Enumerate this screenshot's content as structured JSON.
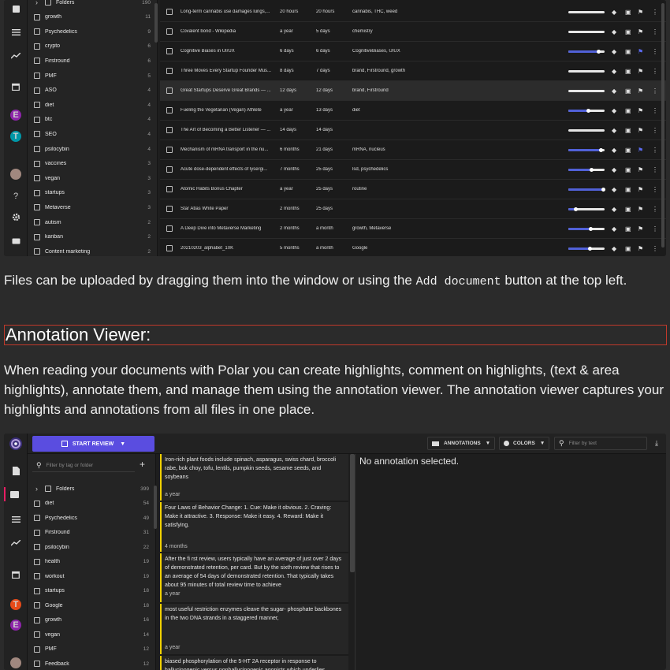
{
  "screenshot1": {
    "tags": [
      {
        "label": "Folders",
        "count": "190"
      },
      {
        "label": "growth",
        "count": "11"
      },
      {
        "label": "Psychedelics",
        "count": "9"
      },
      {
        "label": "crypto",
        "count": "6"
      },
      {
        "label": "Firstround",
        "count": "6"
      },
      {
        "label": "PMF",
        "count": "5"
      },
      {
        "label": "ASO",
        "count": "4"
      },
      {
        "label": "diet",
        "count": "4"
      },
      {
        "label": "btc",
        "count": "4"
      },
      {
        "label": "SEO",
        "count": "4"
      },
      {
        "label": "psilocybin",
        "count": "4"
      },
      {
        "label": "vaccines",
        "count": "3"
      },
      {
        "label": "vegan",
        "count": "3"
      },
      {
        "label": "startups",
        "count": "3"
      },
      {
        "label": "Metaverse",
        "count": "3"
      },
      {
        "label": "autism",
        "count": "2"
      },
      {
        "label": "kanban",
        "count": "2"
      },
      {
        "label": "Content marketing",
        "count": "2"
      }
    ],
    "rail_avatars": [
      {
        "letter": "E",
        "color": "#8e24aa"
      },
      {
        "letter": "T",
        "color": "#0097a7"
      }
    ],
    "rail_help": "?",
    "documents": [
      {
        "title": "Long-term cannabis use damages lungs,...",
        "added": "20 hours",
        "updated": "20 hours",
        "tags": "cannabis, THC, weed",
        "progress": 0
      },
      {
        "title": "Covalent bond - Wikipedia",
        "added": "a year",
        "updated": "5 days",
        "tags": "chemistry",
        "progress": 0
      },
      {
        "title": "Cognitive Biases in UI/UX",
        "added": "6 days",
        "updated": "6 days",
        "tags": "CognitiveBiases, UIUX",
        "progress": 0.82
      },
      {
        "title": "Three Moves Every Startup Founder Mus...",
        "added": "8 days",
        "updated": "7 days",
        "tags": "brand, Firstround, growth",
        "progress": 0
      },
      {
        "title": "Great Startups Deserve Great Brands — ...",
        "added": "12 days",
        "updated": "12 days",
        "tags": "brand, Firstround",
        "progress": 0
      },
      {
        "title": "Fueling the Vegetarian (Vegan) Athlete",
        "added": "a year",
        "updated": "13 days",
        "tags": "diet",
        "progress": 0.55
      },
      {
        "title": "The Art of Becoming a Better Listener — ...",
        "added": "14 days",
        "updated": "14 days",
        "tags": "",
        "progress": 0
      },
      {
        "title": "Mechanism of mRNA transport in the nu...",
        "added": "6 months",
        "updated": "21 days",
        "tags": "mRNA, nucleus",
        "progress": 0.9
      },
      {
        "title": "Acute dose-dependent effects of lysergi...",
        "added": "7 months",
        "updated": "25 days",
        "tags": "lsd, psychedelics",
        "progress": 0.62
      },
      {
        "title": "Atomic Habits Bonus Chapter",
        "added": "a year",
        "updated": "25 days",
        "tags": "routine",
        "progress": 0.95
      },
      {
        "title": "Star Atlas White Paper",
        "added": "2 months",
        "updated": "25 days",
        "tags": "",
        "progress": 0.2
      },
      {
        "title": "A Deep Dive into Metaverse Marketing",
        "added": "2 months",
        "updated": "a month",
        "tags": "growth, Metaverse",
        "progress": 0.6
      },
      {
        "title": "20210203_alphabet_10K",
        "added": "5 months",
        "updated": "a month",
        "tags": "Google",
        "progress": 0.58
      }
    ]
  },
  "paragraph1": {
    "before": "Files can be uploaded by dragging them into the window or using the ",
    "code": "Add document",
    "after": " button at the top left."
  },
  "heading": "Annotation Viewer:",
  "paragraph2": "When reading your documents with Polar you can create highlights, comment on highlights, (text & area highlights), annotate them, and manage them using the annotation viewer. The annotation viewer captures your highlights and annotations from all files in one place.",
  "screenshot2": {
    "start_review": "START REVIEW",
    "annotations_btn": "ANNOTATIONS",
    "colors_btn": "COLORS",
    "filter_placeholder": "Filter by text",
    "tag_filter_placeholder": "Filter by tag or folder",
    "no_selection": "No annotation selected.",
    "rail_avatars": [
      {
        "letter": "T",
        "color": "#e64a19"
      },
      {
        "letter": "E",
        "color": "#8e24aa"
      }
    ],
    "rail_help": "?",
    "tags": [
      {
        "label": "Folders",
        "count": "399"
      },
      {
        "label": "diet",
        "count": "54"
      },
      {
        "label": "Psychedelics",
        "count": "49"
      },
      {
        "label": "Firstround",
        "count": "31"
      },
      {
        "label": "psilocybin",
        "count": "22"
      },
      {
        "label": "health",
        "count": "19"
      },
      {
        "label": "workout",
        "count": "19"
      },
      {
        "label": "startups",
        "count": "18"
      },
      {
        "label": "Google",
        "count": "18"
      },
      {
        "label": "growth",
        "count": "16"
      },
      {
        "label": "vegan",
        "count": "14"
      },
      {
        "label": "PMF",
        "count": "12"
      },
      {
        "label": "Feedback",
        "count": "12"
      }
    ],
    "annotations": [
      {
        "text": "Iron-rich plant foods include spinach, asparagus, swiss chard, broccoli rabe, bok choy, tofu, lentils, pumpkin seeds, sesame seeds, and soybeans",
        "age": "a year"
      },
      {
        "text": "Four Laws of Behavior Change: 1. Cue: Make it obvious. 2. Craving: Make it attractive. 3. Response: Make it easy. 4. Reward: Make it satisfying.",
        "age": "4 months"
      },
      {
        "text": "After the fi rst review, users typically have an average of just over 2 days of demonstrated retention, per card. But by the sixth review that rises to an average of 54 days of demonstrated retention. That typically takes about 95 minutes of total review time to achieve",
        "age": "a year"
      },
      {
        "text": "most useful restriction enzymes cleave the sugar- phosphate backbones in the two DNA strands in a staggered manner,",
        "age": "a year"
      },
      {
        "text": "biased phosphorylation of the 5-HT 2A receptor in response to hallucinogenic versus nonhallucinogenic agonists which underlies",
        "age": ""
      }
    ]
  }
}
